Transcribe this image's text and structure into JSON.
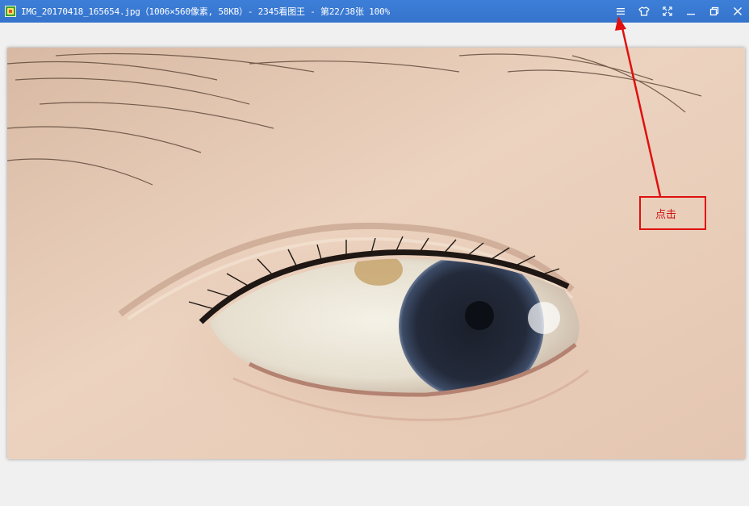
{
  "window": {
    "title": "IMG_20170418_165654.jpg（1006×560像素, 58KB）- 2345看图王 - 第22/38张 100%",
    "titlebar_color": "#3573cc"
  },
  "controls": [
    {
      "name": "menu-icon",
      "label": "Menu"
    },
    {
      "name": "skin-icon",
      "label": "Skin"
    },
    {
      "name": "fullscreen-icon",
      "label": "Fullscreen"
    },
    {
      "name": "minimize-icon",
      "label": "Minimize"
    },
    {
      "name": "restore-icon",
      "label": "Restore"
    },
    {
      "name": "close-icon",
      "label": "Close"
    }
  ],
  "annotation": {
    "label": "点击",
    "color": "#e01010"
  },
  "photo": {
    "subject": "eye-closeup"
  }
}
